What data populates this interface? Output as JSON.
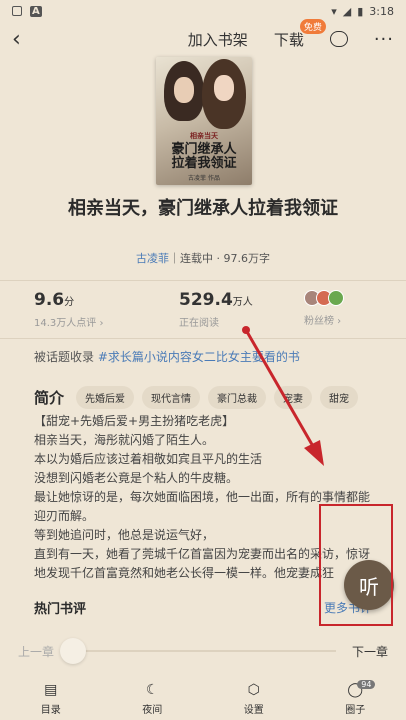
{
  "status": {
    "left_icons": [
      "square-icon",
      "a-icon"
    ],
    "time": "3:18"
  },
  "appbar": {
    "add_shelf": "加入书架",
    "download": "下载",
    "free_badge": "免费"
  },
  "cover": {
    "tagline": "相亲当天",
    "title_line1": "豪门继承人",
    "title_line2": "拉着我领证",
    "author": "古凌菲 作品"
  },
  "book": {
    "title": "相亲当天，豪门继承人拉着我领证",
    "author": "古凌菲",
    "meta_rest": "｜连载中 · 97.6万字"
  },
  "stats": {
    "rating": "9.6",
    "rating_unit": "分",
    "rating_label": "14.3万人点评 ›",
    "reading": "529.4",
    "reading_unit": "万人",
    "reading_label": "正在阅读",
    "fans_label": "粉丝榜 ›"
  },
  "topic": {
    "prefix": "被话题收录",
    "tag": "#求长篇小说内容女二比女主要看的书"
  },
  "intro": {
    "heading": "简介",
    "chips": [
      "先婚后爱",
      "现代言情",
      "豪门总裁",
      "宠妻",
      "甜宠"
    ],
    "lines": [
      "【甜宠+先婚后爱+男主扮猪吃老虎】",
      "相亲当天，海彤就闪婚了陌生人。",
      "本以为婚后应该过着相敬如宾且平凡的生活",
      "没想到闪婚老公竟是个粘人的牛皮糖。",
      "最让她惊讶的是，每次她面临困境，他一出面，所有的事情都能",
      "迎刃而解。",
      "等到她追问时，他总是说运气好，",
      "直到有一天，她看了莞城千亿首富因为宠妻而出名的采访，惊讶",
      "地发现千亿首富竟然和她老公长得一模一样。他宠妻成狂"
    ]
  },
  "hot": {
    "heading": "热门书评",
    "more": "更多书评"
  },
  "listen": "听",
  "chapter": {
    "prev": "上一章",
    "next": "下一章"
  },
  "nav": [
    {
      "label": "目录"
    },
    {
      "label": "夜间"
    },
    {
      "label": "设置"
    },
    {
      "label": "圈子",
      "badge": "94"
    }
  ],
  "colors": {
    "background": "#efe6d6",
    "accent_blue": "#4a7bb7",
    "annotation_red": "#c8262c"
  }
}
